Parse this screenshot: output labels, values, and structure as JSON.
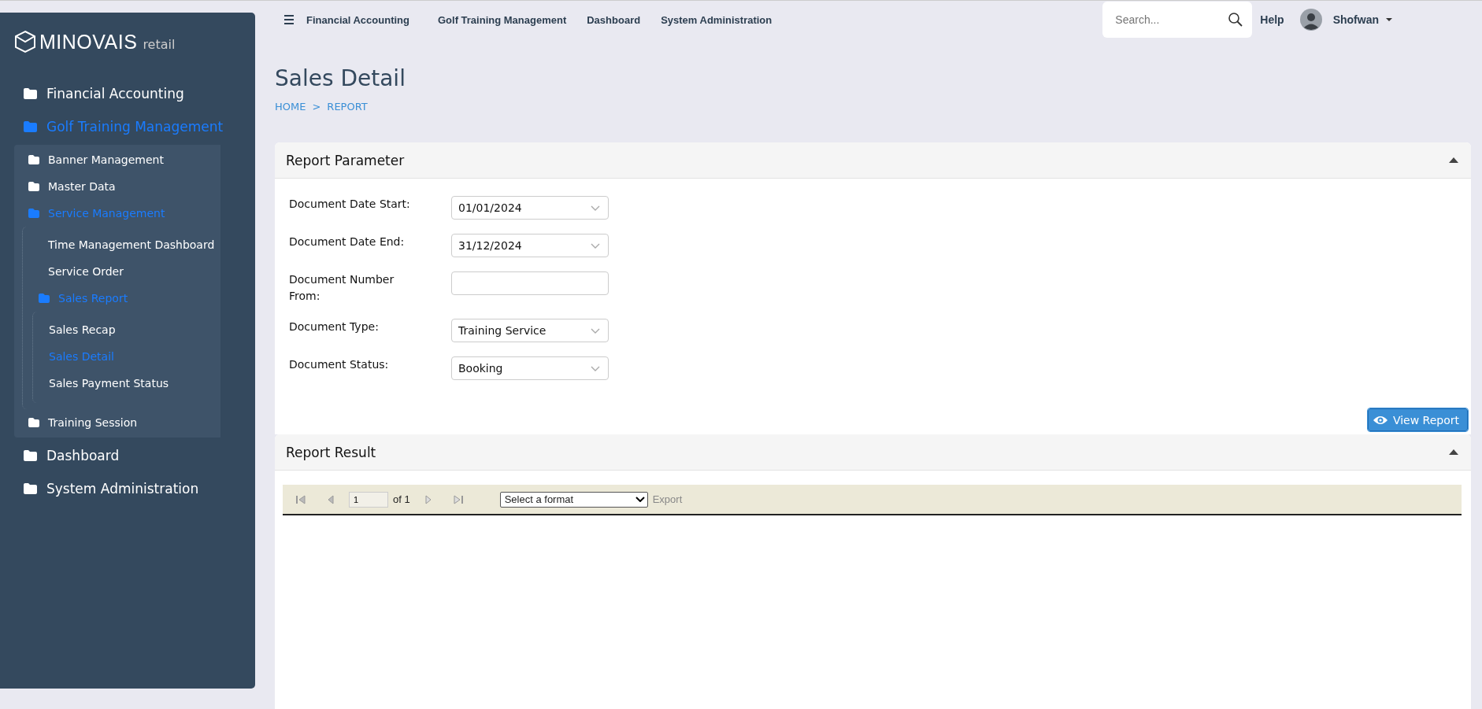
{
  "sidebar": {
    "logo": {
      "brand": "MINOVAIS",
      "suffix": "retail"
    },
    "items": [
      {
        "label": "Financial Accounting",
        "kind": "folder",
        "selected": false
      },
      {
        "label": "Golf Training Management",
        "kind": "folder",
        "selected": true,
        "children": [
          {
            "label": "Banner Management",
            "kind": "folder",
            "selected": false
          },
          {
            "label": "Master Data",
            "kind": "folder",
            "selected": false
          },
          {
            "label": "Service Management",
            "kind": "folder",
            "selected": true,
            "children": [
              {
                "label": "Time Management Dashboard",
                "kind": "page",
                "selected": false
              },
              {
                "label": "Service Order",
                "kind": "page",
                "selected": false
              },
              {
                "label": "Sales Report",
                "kind": "folder",
                "selected": true,
                "children": [
                  {
                    "label": "Sales Recap",
                    "kind": "page",
                    "selected": false
                  },
                  {
                    "label": "Sales Detail",
                    "kind": "page",
                    "selected": true
                  },
                  {
                    "label": "Sales Payment Status",
                    "kind": "page",
                    "selected": false
                  }
                ]
              }
            ]
          },
          {
            "label": "Training Session",
            "kind": "folder",
            "selected": false
          }
        ]
      },
      {
        "label": "Dashboard",
        "kind": "folder",
        "selected": false
      },
      {
        "label": "System Administration",
        "kind": "folder",
        "selected": false
      }
    ]
  },
  "topbar": {
    "menu": [
      "Financial Accounting",
      "Golf Training Management",
      "Dashboard",
      "System Administration"
    ],
    "search": {
      "placeholder": "Search..."
    },
    "help": "Help",
    "user": "Shofwan"
  },
  "page": {
    "title": "Sales Detail",
    "breadcrumb": [
      "HOME",
      "REPORT"
    ],
    "breadcrumb_separator": ">"
  },
  "report_parameter": {
    "title": "Report Parameter",
    "expanded": true,
    "fields": [
      {
        "label": "Document Date Start:",
        "kind": "select",
        "value": "01/01/2024"
      },
      {
        "label": "Document Date End:",
        "kind": "select",
        "value": "31/12/2024"
      },
      {
        "label": "Document Number From:",
        "kind": "text"
      },
      {
        "label": "Document Type:",
        "kind": "select",
        "value": "Training Service"
      },
      {
        "label": "Document Status:",
        "kind": "select",
        "value": "Booking"
      }
    ],
    "button": "View Report"
  },
  "report_result": {
    "title": "Report Result",
    "expanded": true,
    "toolbar": {
      "page": "1",
      "of": "of 1",
      "format": "Select a format",
      "export": "Export"
    }
  }
}
